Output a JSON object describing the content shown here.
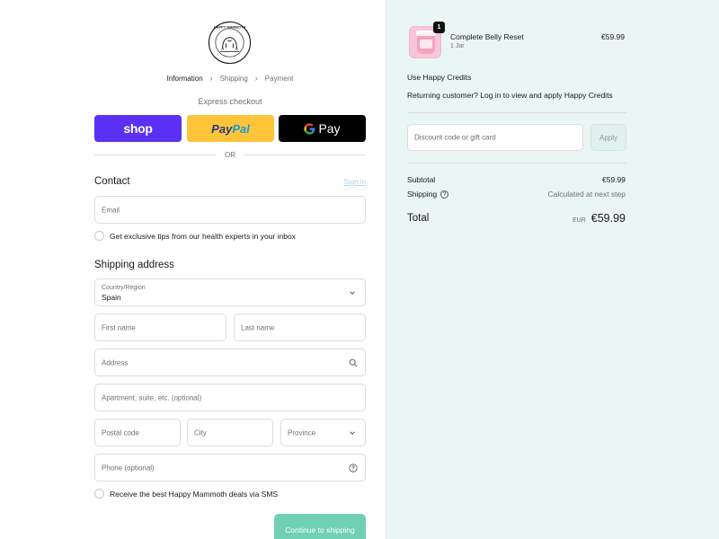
{
  "brand": {
    "logo_alt": "HAPPY MAMMOTH"
  },
  "breadcrumb": {
    "items": [
      "Information",
      "Shipping",
      "Payment"
    ]
  },
  "express": {
    "label": "Express checkout",
    "shop_label": "shop",
    "paypal_pay": "Pay",
    "paypal_pal": "Pal",
    "gpay_label": "Pay",
    "or_label": "OR"
  },
  "contact": {
    "title": "Contact",
    "signin_label": "Sign in",
    "email_placeholder": "Email",
    "tips_label": "Get exclusive tips from our health experts in your inbox"
  },
  "shipping": {
    "title": "Shipping address",
    "country_label": "Country/Region",
    "country_value": "Spain",
    "first_name_placeholder": "First name",
    "last_name_placeholder": "Last name",
    "address_placeholder": "Address",
    "apartment_placeholder": "Apartment, suite, etc. (optional)",
    "postal_placeholder": "Postal code",
    "city_placeholder": "City",
    "province_placeholder": "Province",
    "phone_placeholder": "Phone (optional)",
    "sms_label": "Receive the best Happy Mammoth deals via SMS",
    "continue_label": "Continue to shipping"
  },
  "order": {
    "item": {
      "quantity": "1",
      "name": "Complete Belly Reset",
      "variant": "1 Jar",
      "price": "€59.99"
    },
    "credits_title": "Use Happy Credits",
    "credits_text": "Returning customer? Log in to view and apply Happy Credits",
    "discount_placeholder": "Discount code or gift card",
    "apply_label": "Apply",
    "subtotal_label": "Subtotal",
    "subtotal_value": "€59.99",
    "shipping_label": "Shipping",
    "shipping_value": "Calculated at next step",
    "total_label": "Total",
    "total_currency": "EUR",
    "total_value": "€59.99"
  },
  "colors": {
    "shop_purple": "#5a31f4",
    "paypal_yellow": "#ffc439",
    "gpay_black": "#000000",
    "sidebar_bg": "#eaf6f4",
    "continue_green": "#6fd0b4"
  },
  "icons": [
    "happy-mammoth-logo",
    "chevron-right-icon",
    "google-g-icon",
    "chevron-down-icon",
    "search-icon",
    "help-circle-icon"
  ]
}
